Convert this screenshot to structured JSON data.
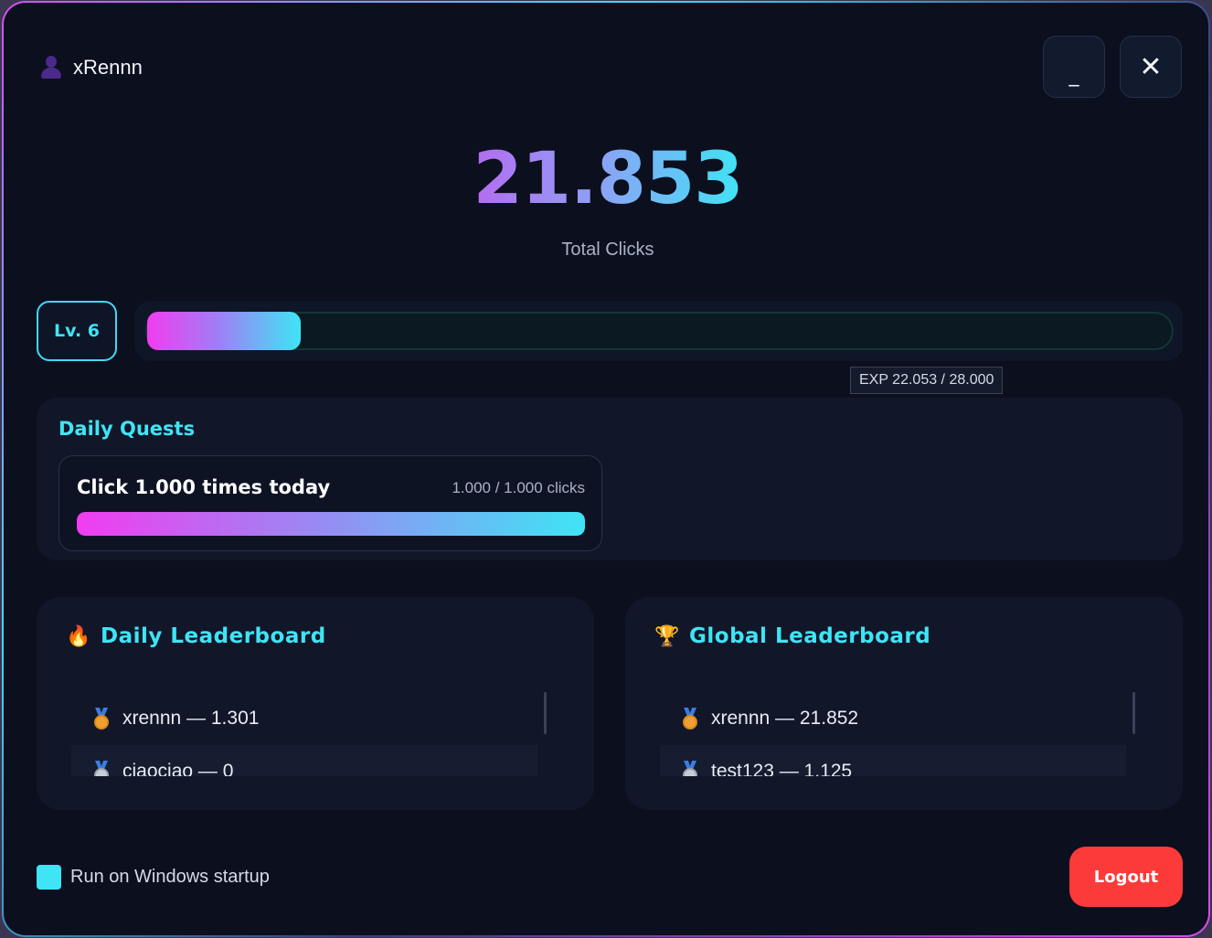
{
  "user": {
    "name": "xRennn",
    "icon": "user-icon"
  },
  "window_controls": {
    "minimize_label": "_",
    "close_label": "✕"
  },
  "stats": {
    "total_clicks": "21.853",
    "total_label": "Total Clicks"
  },
  "level": {
    "label": "Lv. 6",
    "exp_progress": 0.15,
    "exp_tooltip": "EXP 22.053 / 28.000"
  },
  "daily_quests": {
    "title": "Daily Quests",
    "items": [
      {
        "name": "Click 1.000 times today",
        "count": "1.000 / 1.000 clicks",
        "progress": 1.0
      }
    ]
  },
  "daily_leaderboard": {
    "title": "Daily Leaderboard",
    "icon": "fire-icon",
    "rows": [
      {
        "text": "xrennn — 1.301",
        "medal": "gold-medal-icon"
      },
      {
        "text": "ciaociao — 0",
        "medal": "silver-medal-icon"
      }
    ]
  },
  "global_leaderboard": {
    "title": "Global Leaderboard",
    "icon": "trophy-icon",
    "rows": [
      {
        "text": "xrennn — 21.852",
        "medal": "gold-medal-icon"
      },
      {
        "text": "test123 — 1.125",
        "medal": "silver-medal-icon"
      }
    ]
  },
  "footer": {
    "startup_label": "Run on Windows startup",
    "startup_checked": true,
    "logout_label": "Logout"
  },
  "colors": {
    "accent_cyan": "#3fe4f5",
    "accent_magenta": "#f23cf0",
    "logout_red": "#fc3a3a",
    "background": "#0b0f1e"
  }
}
